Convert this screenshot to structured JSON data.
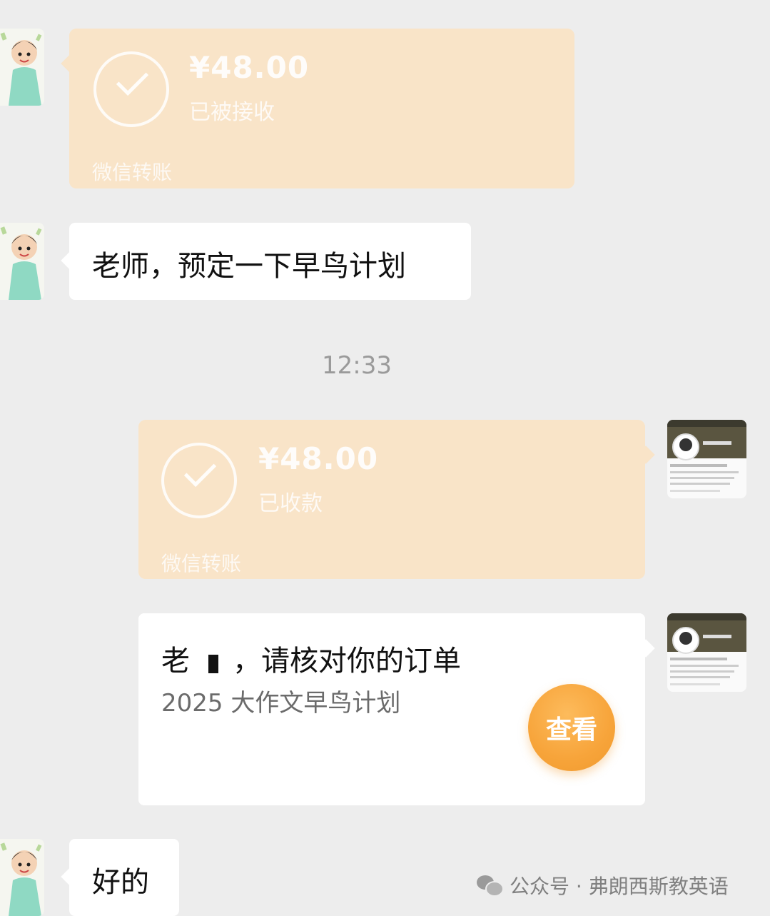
{
  "messages": {
    "transfer_received": {
      "amount": "¥48.00",
      "status": "已被接收",
      "footer": "微信转账"
    },
    "text_reserve": "老师，预定一下早鸟计划",
    "timestamp": "12:33",
    "transfer_collected": {
      "amount": "¥48.00",
      "status": "已收款",
      "footer": "微信转账"
    },
    "order_card": {
      "title_prefix": "老",
      "title_suffix": "，请核对你的订单",
      "subtitle": "2025 大作文早鸟计划",
      "button_label": "查看"
    },
    "text_ok": "好的"
  },
  "watermark": {
    "text": "公众号 · 弗朗西斯教英语"
  },
  "colors": {
    "background": "#ededed",
    "transfer_card": "#f9e4c8",
    "bubble": "#ffffff",
    "view_button": "#f7a43a"
  }
}
